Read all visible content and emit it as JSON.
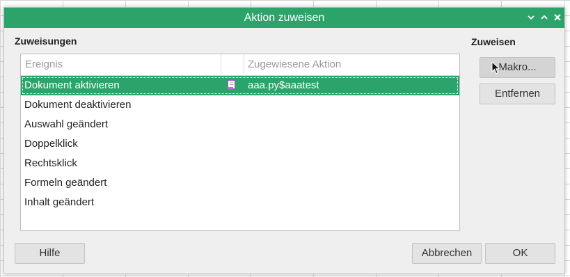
{
  "window": {
    "title": "Aktion zuweisen",
    "controls": {
      "minimize": "⌄",
      "maximize": "⌃",
      "close": "✕"
    }
  },
  "assignments": {
    "label": "Zuweisungen",
    "columns": [
      "Ereignis",
      "Zugewiesene Aktion"
    ],
    "rows": [
      {
        "event": "Dokument aktivieren",
        "action": "aaa.py$aaatest",
        "icon": "macro-script-icon",
        "selected": true
      },
      {
        "event": "Dokument deaktivieren",
        "action": ""
      },
      {
        "event": "Auswahl geändert",
        "action": ""
      },
      {
        "event": "Doppelklick",
        "action": ""
      },
      {
        "event": "Rechtsklick",
        "action": ""
      },
      {
        "event": "Formeln geändert",
        "action": ""
      },
      {
        "event": "Inhalt geändert",
        "action": ""
      }
    ]
  },
  "assign": {
    "label": "Zuweisen",
    "macro_button": "Makro...",
    "remove_button": "Entfernen"
  },
  "footer": {
    "help_button": "Hilfe",
    "cancel_button": "Abbrechen",
    "ok_button": "OK"
  },
  "colors": {
    "accent": "#2ca36b",
    "dialog_bg": "#efefef",
    "button_bg": "#e3e3e3"
  }
}
